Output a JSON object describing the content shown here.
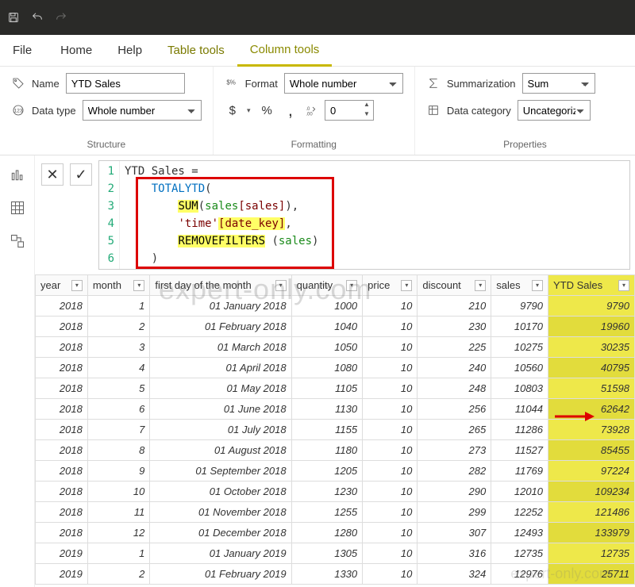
{
  "titlebar": {
    "save": "save",
    "undo": "undo",
    "redo": "redo"
  },
  "tabs": {
    "file": "File",
    "home": "Home",
    "help": "Help",
    "table_tools": "Table tools",
    "column_tools": "Column tools"
  },
  "ribbon": {
    "structure": {
      "name_label": "Name",
      "name_value": "YTD Sales",
      "datatype_label": "Data type",
      "datatype_value": "Whole number",
      "caption": "Structure"
    },
    "formatting": {
      "format_label": "Format",
      "format_value": "Whole number",
      "decimals": "0",
      "caption": "Formatting",
      "currency": "$",
      "percent": "%",
      "comma": ","
    },
    "properties": {
      "sum_label": "Summarization",
      "sum_value": "Sum",
      "cat_label": "Data category",
      "cat_value": "Uncategorized",
      "caption": "Properties"
    }
  },
  "formula": {
    "lines": [
      "1",
      "2",
      "3",
      "4",
      "5",
      "6"
    ],
    "l1a": "YTD Sales ",
    "l1b": "=",
    "l2a": "TOTALYTD",
    "l2b": "(",
    "l3a": "SUM",
    "l3b": "(",
    "l3c": "sales",
    "l3d": "[sales]",
    "l3e": "),",
    "l4a": "'time'",
    "l4b": "[date_key]",
    "l4c": ",",
    "l5a": "REMOVEFILTERS",
    "l5b": " (",
    "l5c": "sales",
    "l5d": ")",
    "l6": ")"
  },
  "grid": {
    "headers": [
      "year",
      "month",
      "first day of the month",
      "quantity",
      "price",
      "discount",
      "sales",
      "YTD Sales"
    ],
    "rows": [
      {
        "year": "2018",
        "month": "1",
        "fdom": "01 January 2018",
        "qty": "1000",
        "price": "10",
        "disc": "210",
        "sales": "9790",
        "ytd": "9790"
      },
      {
        "year": "2018",
        "month": "2",
        "fdom": "01 February 2018",
        "qty": "1040",
        "price": "10",
        "disc": "230",
        "sales": "10170",
        "ytd": "19960"
      },
      {
        "year": "2018",
        "month": "3",
        "fdom": "01 March 2018",
        "qty": "1050",
        "price": "10",
        "disc": "225",
        "sales": "10275",
        "ytd": "30235"
      },
      {
        "year": "2018",
        "month": "4",
        "fdom": "01 April 2018",
        "qty": "1080",
        "price": "10",
        "disc": "240",
        "sales": "10560",
        "ytd": "40795"
      },
      {
        "year": "2018",
        "month": "5",
        "fdom": "01 May 2018",
        "qty": "1105",
        "price": "10",
        "disc": "248",
        "sales": "10803",
        "ytd": "51598"
      },
      {
        "year": "2018",
        "month": "6",
        "fdom": "01 June 2018",
        "qty": "1130",
        "price": "10",
        "disc": "256",
        "sales": "11044",
        "ytd": "62642"
      },
      {
        "year": "2018",
        "month": "7",
        "fdom": "01 July 2018",
        "qty": "1155",
        "price": "10",
        "disc": "265",
        "sales": "11286",
        "ytd": "73928"
      },
      {
        "year": "2018",
        "month": "8",
        "fdom": "01 August 2018",
        "qty": "1180",
        "price": "10",
        "disc": "273",
        "sales": "11527",
        "ytd": "85455"
      },
      {
        "year": "2018",
        "month": "9",
        "fdom": "01 September 2018",
        "qty": "1205",
        "price": "10",
        "disc": "282",
        "sales": "11769",
        "ytd": "97224"
      },
      {
        "year": "2018",
        "month": "10",
        "fdom": "01 October 2018",
        "qty": "1230",
        "price": "10",
        "disc": "290",
        "sales": "12010",
        "ytd": "109234"
      },
      {
        "year": "2018",
        "month": "11",
        "fdom": "01 November 2018",
        "qty": "1255",
        "price": "10",
        "disc": "299",
        "sales": "12252",
        "ytd": "121486"
      },
      {
        "year": "2018",
        "month": "12",
        "fdom": "01 December 2018",
        "qty": "1280",
        "price": "10",
        "disc": "307",
        "sales": "12493",
        "ytd": "133979"
      },
      {
        "year": "2019",
        "month": "1",
        "fdom": "01 January 2019",
        "qty": "1305",
        "price": "10",
        "disc": "316",
        "sales": "12735",
        "ytd": "12735"
      },
      {
        "year": "2019",
        "month": "2",
        "fdom": "01 February 2019",
        "qty": "1330",
        "price": "10",
        "disc": "324",
        "sales": "12976",
        "ytd": "25711"
      }
    ]
  },
  "watermark": "expert-only.com",
  "watermark2": "expert-only.com"
}
